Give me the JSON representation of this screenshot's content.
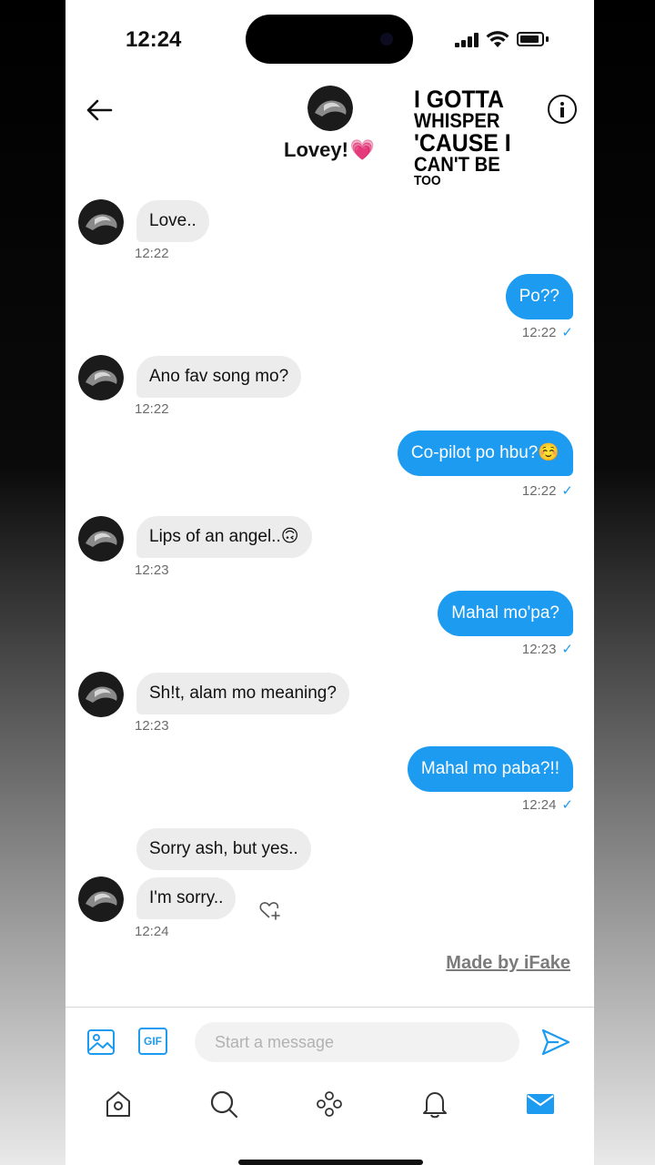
{
  "status_bar": {
    "time": "12:24"
  },
  "header": {
    "name": "Lovey!",
    "name_emoji": "💗",
    "back_icon": "arrow-left-icon",
    "info_icon": "info-icon"
  },
  "overlay_lyric": {
    "line1": "I GOTTA",
    "line2": "WHISPER",
    "line3": "'CAUSE I",
    "line4": "CAN'T BE",
    "line5": "TOO"
  },
  "messages": [
    {
      "side": "in",
      "text": "Love..",
      "time": "12:22"
    },
    {
      "side": "out",
      "text": "Po??",
      "time": "12:22"
    },
    {
      "side": "in",
      "text": "Ano fav song mo?",
      "time": "12:22"
    },
    {
      "side": "out",
      "text": "Co-pilot po hbu?☺️",
      "time": "12:22"
    },
    {
      "side": "in",
      "text": "Lips of an angel..🙃",
      "time": "12:23"
    },
    {
      "side": "out",
      "text": "Mahal mo'pa?",
      "time": "12:23"
    },
    {
      "side": "in",
      "text": "Sh!t, alam mo meaning?",
      "time": "12:23"
    },
    {
      "side": "out",
      "text": "Mahal mo paba?!!",
      "time": "12:24"
    },
    {
      "side": "in",
      "text": "Sorry ash, but yes..",
      "time": ""
    },
    {
      "side": "in",
      "text": "I'm sorry..",
      "time": "12:24"
    }
  ],
  "read_check": "✓",
  "watermark": "Made by iFake",
  "composer": {
    "placeholder": "Start a message",
    "gif_label": "GIF"
  },
  "tab_bar": {
    "items": [
      "home-icon",
      "search-icon",
      "spaces-icon",
      "notifications-icon",
      "messages-icon"
    ],
    "active": "messages-icon"
  },
  "colors": {
    "accent": "#1d9bf0",
    "incoming_bubble": "#ececec",
    "timestamp": "#6b6b6b"
  }
}
